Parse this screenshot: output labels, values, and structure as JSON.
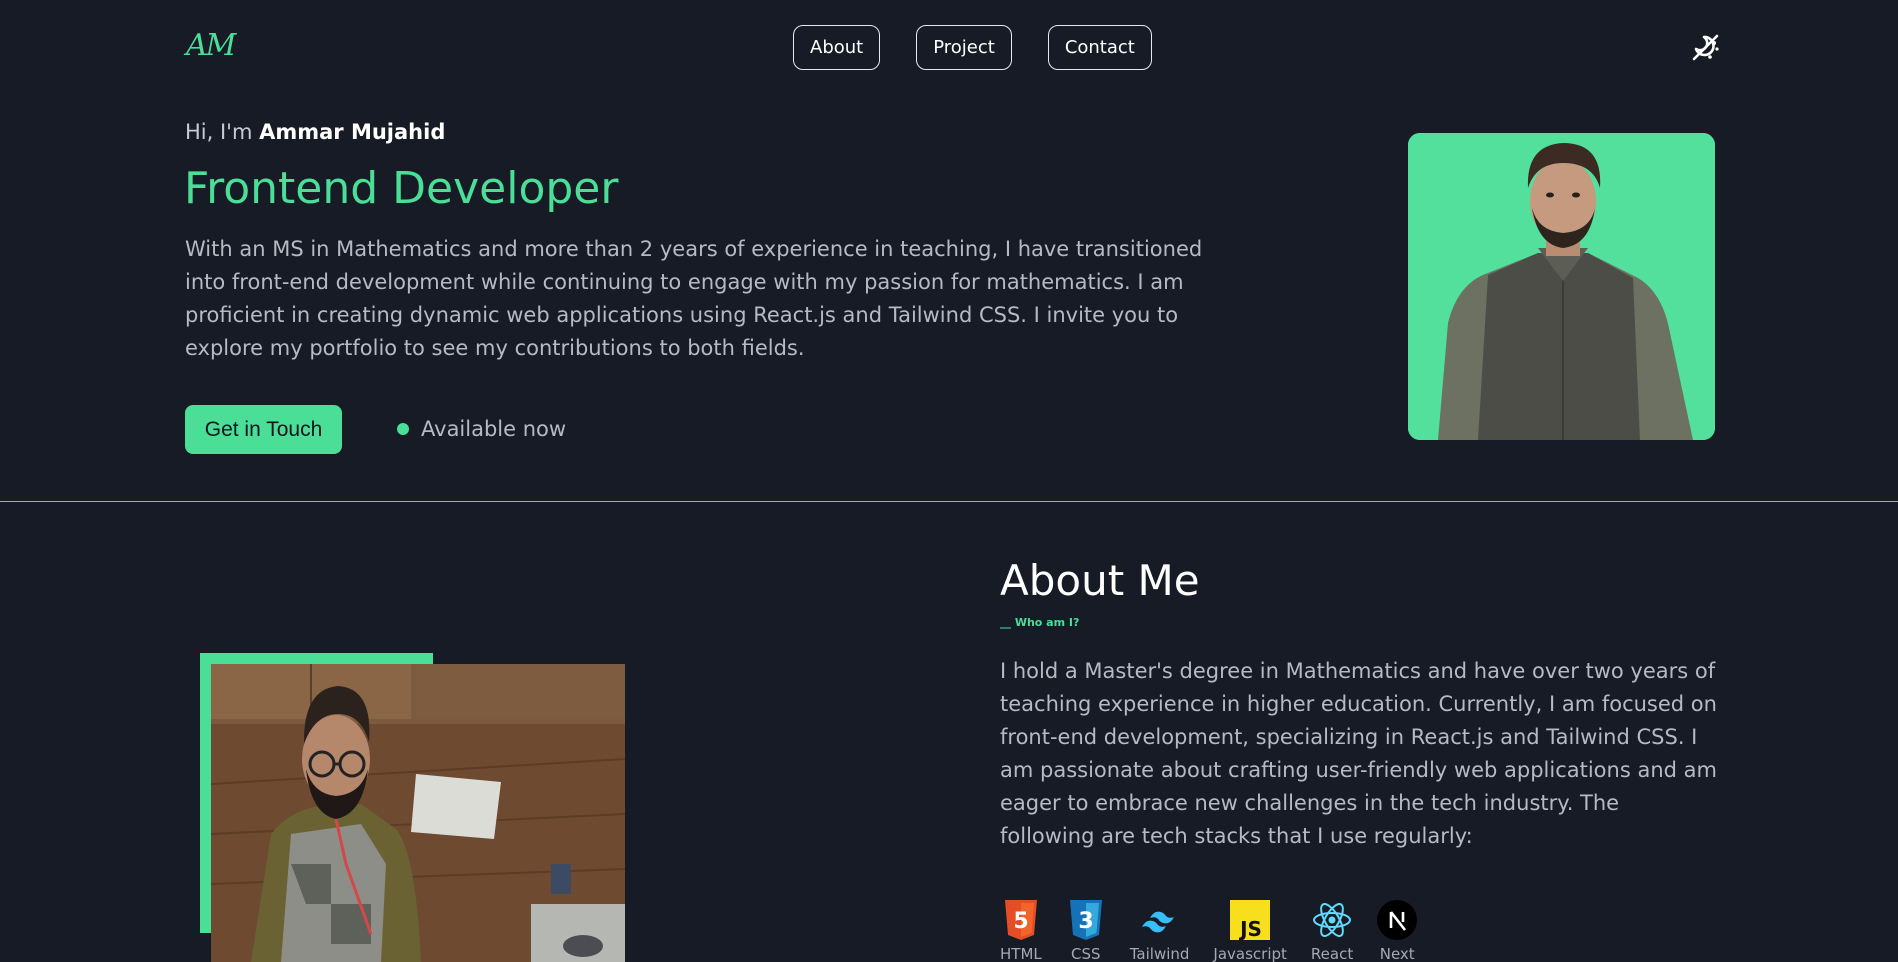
{
  "nav": {
    "logo": "AM",
    "links": [
      "About",
      "Project",
      "Contact"
    ],
    "theme_toggle_icon": "theme-toggle-icon"
  },
  "hero": {
    "greeting_prefix": "Hi, I'm",
    "name": "Ammar Mujahid",
    "title": "Frontend Developer",
    "description": "With an MS in Mathematics and more than 2 years of experience in teaching, I have transitioned into front-end development while continuing to engage with my passion for mathematics. I am proficient in creating dynamic web applications using React.js and Tailwind CSS. I invite you to explore my portfolio to see my contributions to both fields.",
    "cta_label": "Get in Touch",
    "status": "Available now"
  },
  "about": {
    "title": "About Me",
    "subtitle": "__ Who am I?",
    "text": "I hold a Master's degree in Mathematics and have over two years of teaching experience in higher education. Currently, I am focused on front-end development, specializing in React.js and Tailwind CSS. I am passionate about crafting user-friendly web applications and am eager to embrace new challenges in the tech industry. The following are tech stacks that I use regularly:",
    "stack": [
      "HTML",
      "CSS",
      "Tailwind",
      "Javascript",
      "React",
      "Next"
    ]
  },
  "colors": {
    "accent": "#4ade97",
    "background": "#161b26",
    "text": "#b7bac2"
  }
}
